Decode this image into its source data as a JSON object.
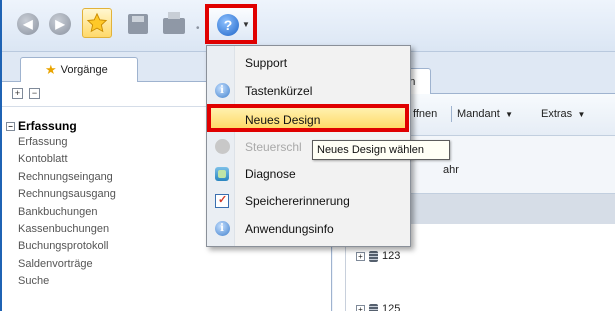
{
  "toolbar": {
    "back_icon": "back-arrow-icon",
    "forward_icon": "forward-arrow-icon",
    "favorite_icon": "star-icon",
    "save_icon": "save-icon",
    "print_icon": "print-icon",
    "help_icon": "help-question-icon"
  },
  "left_panel": {
    "tab_label": "Vorgänge",
    "tree": {
      "group_label": "Erfassung",
      "items": [
        "Erfassung",
        "Kontoblatt",
        "Rechnungseingang",
        "Rechnungsausgang",
        "Bankbuchungen",
        "Kassenbuchungen",
        "Buchungsprotokoll",
        "Saldenvorträge",
        "Suche"
      ]
    }
  },
  "right_panel": {
    "tab_label_partial": "nten",
    "toolbar": {
      "open_partial": "ffnen",
      "client_label": "Mandant",
      "extras_label": "Extras"
    },
    "header_partial": "ahr",
    "rows": [
      "123",
      "125"
    ]
  },
  "help_menu": {
    "items": [
      {
        "label": "Support",
        "icon": "none",
        "state": "normal"
      },
      {
        "label": "Tastenkürzel",
        "icon": "info-icon",
        "state": "normal"
      },
      {
        "label": "Neues Design",
        "icon": "none",
        "state": "selected"
      },
      {
        "label": "Steuerschl",
        "icon": "grey-icon",
        "state": "disabled"
      },
      {
        "label": "Diagnose",
        "icon": "diagnose-icon",
        "state": "normal"
      },
      {
        "label": "Speichererinnerung",
        "icon": "memory-icon",
        "state": "normal"
      },
      {
        "label": "Anwendungsinfo",
        "icon": "info-icon",
        "state": "normal"
      }
    ]
  },
  "tooltip": {
    "text": "Neues Design wählen"
  },
  "colors": {
    "highlight_red": "#e00000",
    "selection_yellow": "#ffd65a",
    "accent_blue": "#1f63b4"
  }
}
